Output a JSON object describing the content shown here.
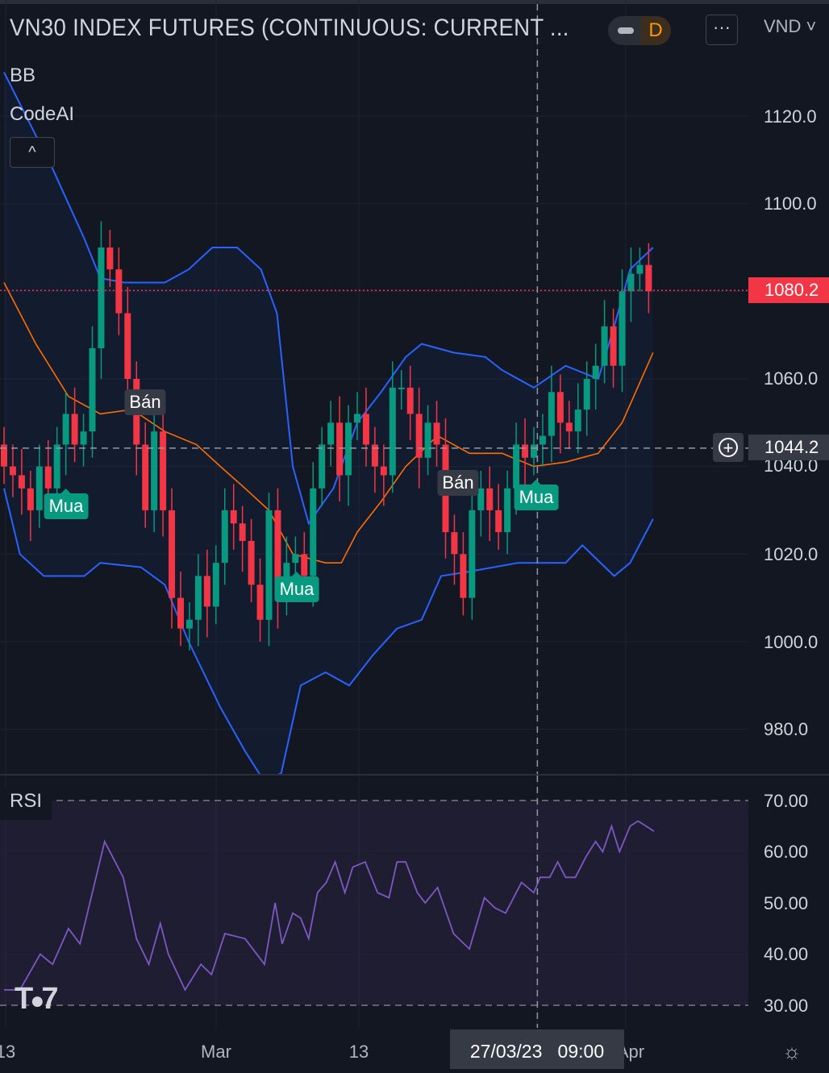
{
  "header": {
    "title": "VN30 INDEX FUTURES (CONTINUOUS: CURRENT ...",
    "interval": "D",
    "more_label": "···",
    "currency": "VND ˅"
  },
  "indicators": {
    "bb": "BB",
    "codeai": "CodeAI",
    "collapse": "^",
    "rsi": "RSI"
  },
  "price_axis": {
    "ticks": [
      "1120.0",
      "1100.0",
      "1060.0",
      "1040.0",
      "1020.0",
      "1000.0",
      "980.0"
    ],
    "last_price": "1080.2",
    "crosshair_price": "1044.2"
  },
  "rsi_axis": {
    "ticks": [
      "70.00",
      "60.00",
      "50.00",
      "40.00",
      "30.00"
    ]
  },
  "time_axis": {
    "labels": [
      "13",
      "Mar",
      "13",
      "Apr"
    ],
    "crosshair": "27/03/23   09:00"
  },
  "markers": [
    {
      "type": "sell",
      "label": "Bán"
    },
    {
      "type": "buy",
      "label": "Mua"
    },
    {
      "type": "buy",
      "label": "Mua"
    },
    {
      "type": "sell",
      "label": "Bán"
    },
    {
      "type": "buy",
      "label": "Mua"
    }
  ],
  "logo": "TV",
  "settings_icon": "gear-icon",
  "colors": {
    "up": "#089981",
    "down": "#f23645",
    "bb_band": "#2962ff",
    "bb_basis": "#ff6d00",
    "rsi": "#7e57c2",
    "bg": "#131722"
  },
  "chart_data": [
    {
      "type": "candlestick",
      "title": "VN30 INDEX FUTURES",
      "ylim": [
        970,
        1128
      ],
      "y_ticks": [
        980,
        1000,
        1020,
        1040,
        1060,
        1100,
        1120
      ],
      "last_price": 1080.2,
      "crosshair": {
        "price": 1044.2,
        "bar": 60.4
      },
      "first_open": 1045,
      "close": [
        1040,
        1038,
        1035,
        1030,
        1040,
        1035,
        1045,
        1052,
        1045,
        1048,
        1067,
        1090,
        1085,
        1075,
        1060,
        1045,
        1030,
        1048,
        1030,
        1010,
        1003,
        1005,
        1015,
        1008,
        1018,
        1030,
        1027,
        1023,
        1013,
        1005,
        1030,
        1010,
        1018,
        1020,
        1015,
        1035,
        1045,
        1050,
        1038,
        1050,
        1052,
        1045,
        1040,
        1038,
        1058,
        1058,
        1052,
        1042,
        1050,
        1045,
        1025,
        1020,
        1010,
        1030,
        1035,
        1030,
        1025,
        1035,
        1045,
        1042,
        1045,
        1047,
        1057,
        1050,
        1048,
        1053,
        1060,
        1063,
        1072,
        1063,
        1080,
        1084,
        1086,
        1080
      ],
      "bb_upper": [
        [
          0,
          1130
        ],
        [
          5.5,
          1108
        ],
        [
          9.1,
          1092
        ],
        [
          10.9,
          1083
        ],
        [
          13.6,
          1082
        ],
        [
          18.2,
          1082
        ],
        [
          20.9,
          1085
        ],
        [
          23.6,
          1090
        ],
        [
          26.4,
          1090
        ],
        [
          29.1,
          1085
        ],
        [
          30.9,
          1075
        ],
        [
          32.7,
          1040
        ],
        [
          34.5,
          1027
        ],
        [
          37.3,
          1035
        ],
        [
          40,
          1050
        ],
        [
          42.7,
          1057
        ],
        [
          45.5,
          1065
        ],
        [
          47.3,
          1068
        ],
        [
          50.9,
          1066
        ],
        [
          54.5,
          1065
        ],
        [
          56.4,
          1062
        ],
        [
          60,
          1058
        ],
        [
          63.6,
          1063
        ],
        [
          67.3,
          1060
        ],
        [
          69.1,
          1072
        ],
        [
          70.9,
          1085
        ],
        [
          73.5,
          1090
        ]
      ],
      "bb_basis": [
        [
          0,
          1082
        ],
        [
          3.6,
          1068
        ],
        [
          7.3,
          1056
        ],
        [
          10.9,
          1052
        ],
        [
          14.5,
          1053
        ],
        [
          18.2,
          1048
        ],
        [
          21.8,
          1045
        ],
        [
          24.5,
          1040
        ],
        [
          27.3,
          1035
        ],
        [
          30,
          1030
        ],
        [
          32.7,
          1020
        ],
        [
          36.4,
          1018
        ],
        [
          38.2,
          1018
        ],
        [
          40,
          1025
        ],
        [
          42.7,
          1032
        ],
        [
          45.5,
          1040
        ],
        [
          49.1,
          1047
        ],
        [
          52.7,
          1043
        ],
        [
          56.4,
          1043
        ],
        [
          60,
          1040
        ],
        [
          63.6,
          1041
        ],
        [
          67.3,
          1043
        ],
        [
          70,
          1050
        ],
        [
          73.5,
          1066
        ]
      ],
      "bb_lower": [
        [
          0,
          1035
        ],
        [
          1.8,
          1020
        ],
        [
          4.5,
          1015
        ],
        [
          9.1,
          1015
        ],
        [
          10.9,
          1018
        ],
        [
          15.5,
          1017
        ],
        [
          18.2,
          1013
        ],
        [
          20.9,
          1000
        ],
        [
          24.5,
          985
        ],
        [
          27.3,
          975
        ],
        [
          29.5,
          968
        ],
        [
          31.4,
          970
        ],
        [
          33.6,
          990
        ],
        [
          36.4,
          993
        ],
        [
          39.1,
          990
        ],
        [
          41.8,
          997
        ],
        [
          44.5,
          1003
        ],
        [
          47.3,
          1005
        ],
        [
          49.5,
          1015
        ],
        [
          52.7,
          1016
        ],
        [
          58.2,
          1018
        ],
        [
          63.6,
          1018
        ],
        [
          65.5,
          1022
        ],
        [
          69.1,
          1015
        ],
        [
          70.9,
          1018
        ],
        [
          73.5,
          1028
        ]
      ],
      "signals": [
        {
          "bar": 16,
          "price": 1054
        },
        {
          "bar": 7,
          "price": 1028
        },
        {
          "bar": 33,
          "price": 1008
        },
        {
          "bar": 51,
          "price": 1036
        },
        {
          "bar": 60,
          "price": 1030
        }
      ]
    },
    {
      "type": "line",
      "title": "RSI",
      "ylim": [
        30,
        70
      ],
      "y_ticks": [
        30,
        40,
        50,
        60,
        70
      ],
      "points": [
        [
          0,
          33
        ],
        [
          1.8,
          33
        ],
        [
          4.1,
          40
        ],
        [
          5.5,
          38
        ],
        [
          7.3,
          45
        ],
        [
          8.6,
          42
        ],
        [
          10,
          52
        ],
        [
          11.4,
          62
        ],
        [
          13.5,
          55
        ],
        [
          15,
          43
        ],
        [
          16.4,
          38
        ],
        [
          17.7,
          46
        ],
        [
          18.6,
          40
        ],
        [
          20.5,
          33
        ],
        [
          22.3,
          38
        ],
        [
          23.5,
          36
        ],
        [
          25,
          44
        ],
        [
          27.3,
          43
        ],
        [
          29.5,
          38
        ],
        [
          30.7,
          50
        ],
        [
          31.5,
          42
        ],
        [
          32.7,
          48
        ],
        [
          33.6,
          47
        ],
        [
          34.5,
          43
        ],
        [
          35.5,
          52
        ],
        [
          36.5,
          54
        ],
        [
          37.5,
          58
        ],
        [
          38.6,
          52
        ],
        [
          39.5,
          57
        ],
        [
          40.9,
          58
        ],
        [
          42.3,
          52
        ],
        [
          43.6,
          51
        ],
        [
          44.5,
          58
        ],
        [
          45.5,
          58
        ],
        [
          46.8,
          52
        ],
        [
          47.7,
          50
        ],
        [
          49.1,
          53
        ],
        [
          50.9,
          44
        ],
        [
          52.7,
          41
        ],
        [
          54.4,
          51
        ],
        [
          55.6,
          49
        ],
        [
          56.8,
          48
        ],
        [
          58.6,
          54
        ],
        [
          60,
          52
        ],
        [
          60.7,
          55
        ],
        [
          61.8,
          55
        ],
        [
          62.7,
          58
        ],
        [
          63.6,
          55
        ],
        [
          64.7,
          55
        ],
        [
          65.9,
          59
        ],
        [
          67,
          62
        ],
        [
          67.8,
          60
        ],
        [
          68.8,
          65
        ],
        [
          69.7,
          60
        ],
        [
          70.9,
          65
        ],
        [
          71.8,
          66
        ],
        [
          72.7,
          65
        ],
        [
          73.6,
          64
        ]
      ]
    }
  ]
}
